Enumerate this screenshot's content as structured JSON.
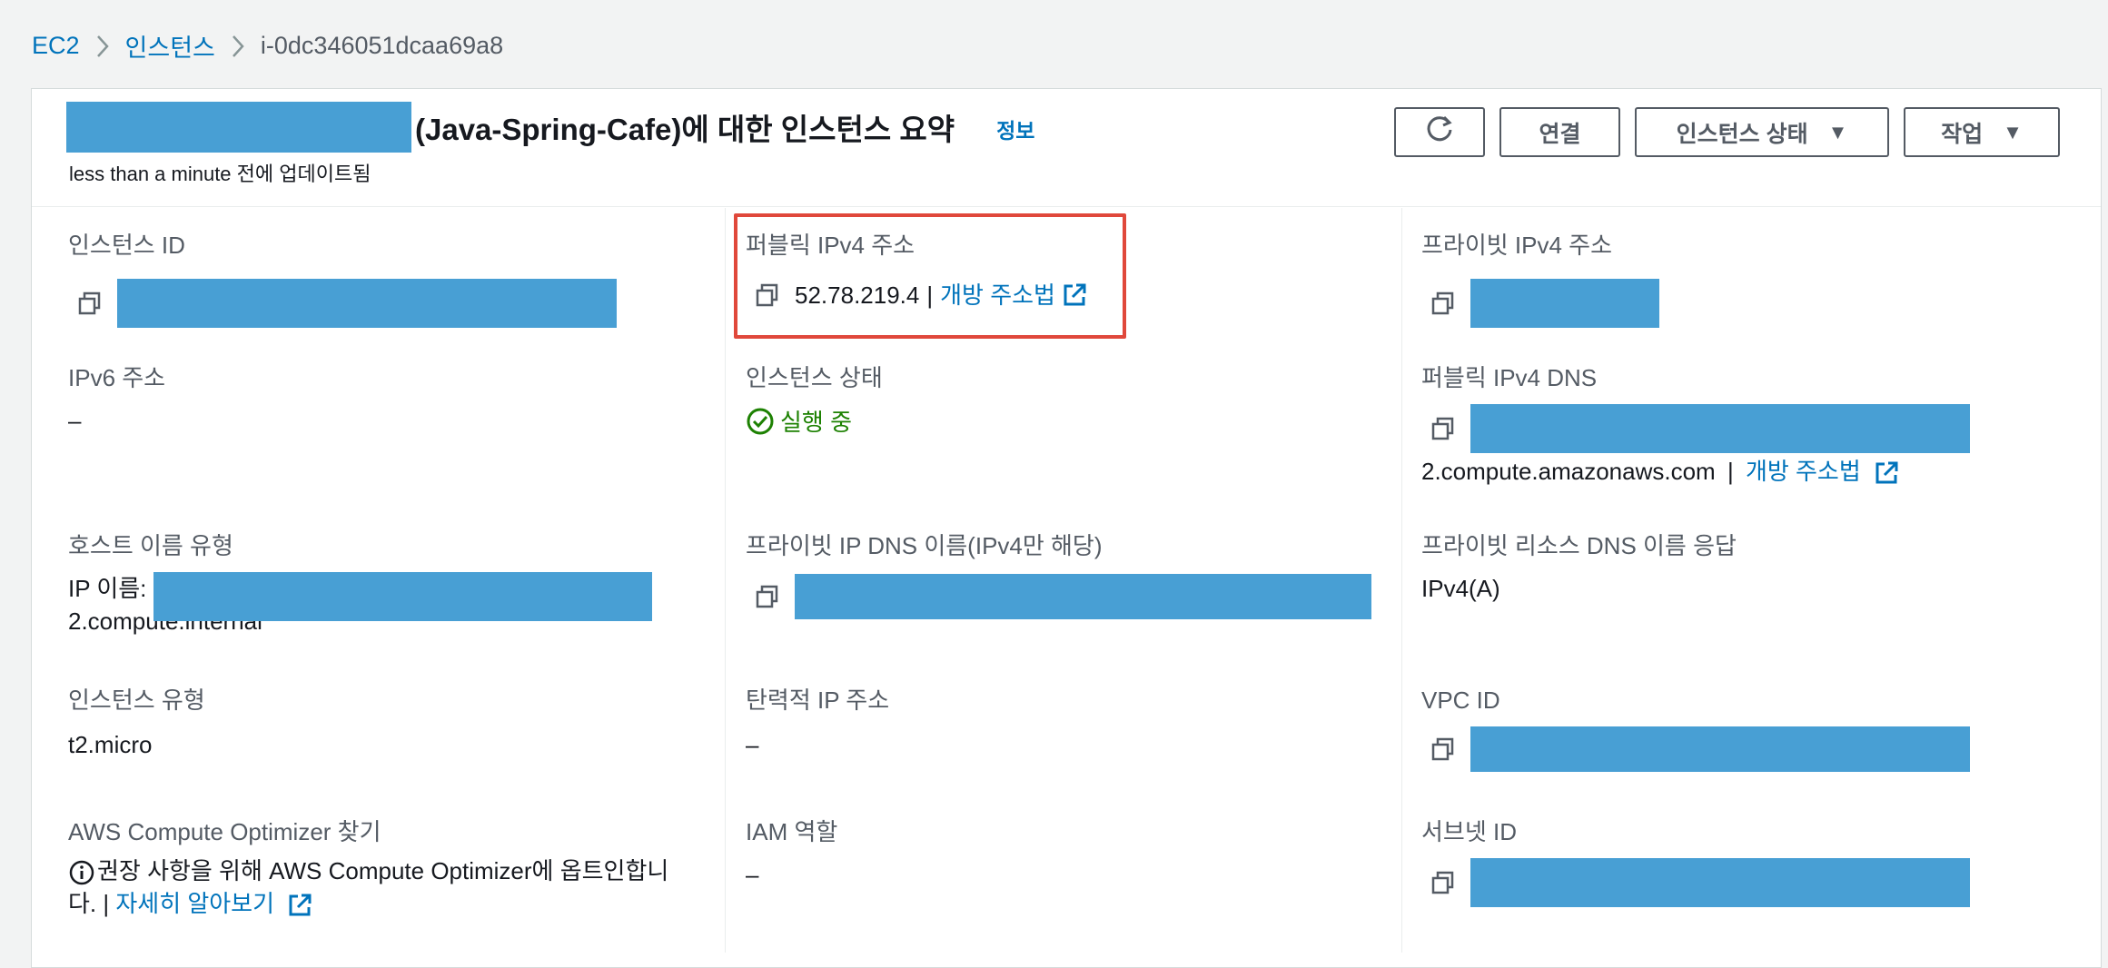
{
  "breadcrumb": {
    "items": [
      "EC2",
      "인스턴스",
      "i-0dc346051dcaa69a8"
    ]
  },
  "header": {
    "title_suffix": "(Java-Spring-Cafe)에 대한 인스턴스 요약",
    "info_link": "정보",
    "updated": "less than a minute 전에 업데이트됨",
    "buttons": {
      "connect": "연결",
      "instance_state": "인스턴스 상태",
      "actions": "작업"
    }
  },
  "fields": {
    "instance_id": {
      "label": "인스턴스 ID"
    },
    "public_ipv4": {
      "label": "퍼블릭 IPv4 주소",
      "value": "52.78.219.4",
      "separator": "|",
      "link": "개방 주소법"
    },
    "private_ipv4": {
      "label": "프라이빗 IPv4 주소"
    },
    "ipv6": {
      "label": "IPv6 주소",
      "value": "–"
    },
    "instance_state": {
      "label": "인스턴스 상태",
      "value": "실행 중"
    },
    "public_dns": {
      "label": "퍼블릭 IPv4 DNS",
      "value": "2.compute.amazonaws.com",
      "separator": "|",
      "link": "개방 주소법"
    },
    "hostname_type": {
      "label": "호스트 이름 유형",
      "value_line1": "IP 이름:",
      "value_line2": "2.compute.internal"
    },
    "private_ip_dns": {
      "label": "프라이빗 IP DNS 이름(IPv4만 해당)"
    },
    "private_resource_dns": {
      "label": "프라이빗 리소스 DNS 이름 응답",
      "value": "IPv4(A)"
    },
    "instance_type": {
      "label": "인스턴스 유형",
      "value": "t2.micro"
    },
    "elastic_ip": {
      "label": "탄력적 IP 주소",
      "value": "–"
    },
    "vpc_id": {
      "label": "VPC ID"
    },
    "compute_optimizer": {
      "label": "AWS Compute Optimizer 찾기",
      "line1": "권장 사항을 위해 AWS Compute Optimizer에 옵트인합니",
      "line2_prefix": "다. |",
      "link": "자세히 알아보기"
    },
    "iam_role": {
      "label": "IAM 역할",
      "value": "–"
    },
    "subnet_id": {
      "label": "서브넷 ID"
    }
  },
  "colors": {
    "link": "#0073bb",
    "redaction": "#489fd4",
    "success": "#1d8102",
    "highlight": "#e0483b"
  },
  "icons": [
    "chevron-right-icon",
    "refresh-icon",
    "caret-down-icon",
    "copy-icon",
    "external-link-icon",
    "check-circle-icon",
    "info-icon"
  ]
}
